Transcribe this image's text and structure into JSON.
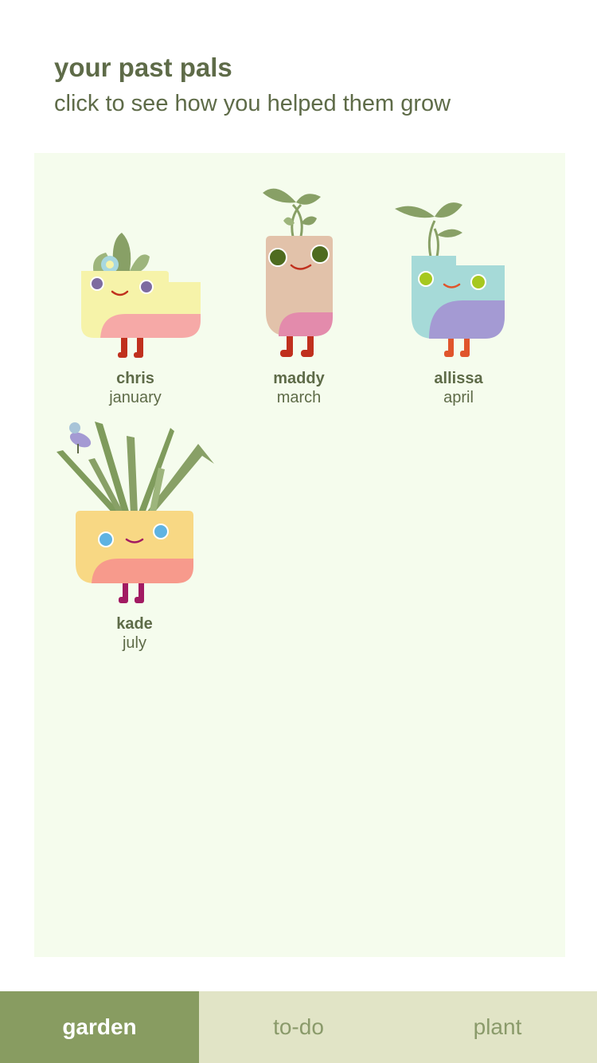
{
  "header": {
    "title": "your past pals",
    "subtitle": "click to see how you helped them grow"
  },
  "pals": [
    {
      "name": "chris",
      "month": "january",
      "colors": {
        "pot": "#f6f3a9",
        "belly": "#f6a9a7",
        "legs": "#c0301e",
        "eyes": "#7d6ba0",
        "plant": "#88a066",
        "flower": "#a8d8e0"
      }
    },
    {
      "name": "maddy",
      "month": "march",
      "colors": {
        "pot": "#e2c2aa",
        "belly": "#e38bac",
        "legs": "#c0301e",
        "eyes": "#4e6b1f",
        "plant": "#88a066"
      }
    },
    {
      "name": "allissa",
      "month": "april",
      "colors": {
        "pot": "#a6dad8",
        "belly": "#a49ad3",
        "legs": "#e0552c",
        "eyes": "#a6c81f",
        "plant": "#88a066"
      }
    },
    {
      "name": "kade",
      "month": "july",
      "colors": {
        "pot": "#f8d884",
        "belly": "#f79a8c",
        "legs": "#a21a62",
        "eyes": "#5fb3e2",
        "plant": "#7f9b5c",
        "bird": "#a49ad3"
      }
    }
  ],
  "nav": {
    "tabs": [
      {
        "label": "garden",
        "active": true
      },
      {
        "label": "to-do",
        "active": false
      },
      {
        "label": "plant",
        "active": false
      }
    ]
  }
}
